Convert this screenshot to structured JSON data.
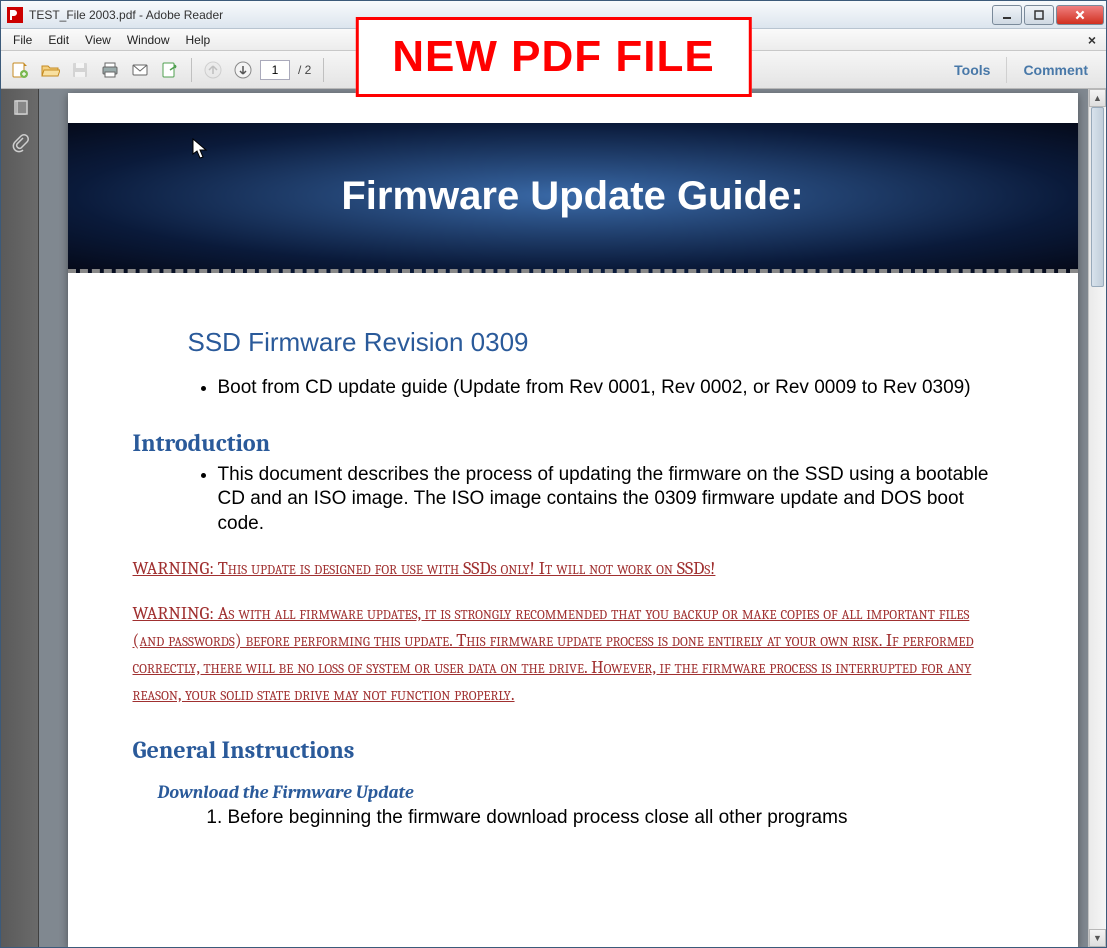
{
  "window": {
    "title": "TEST_File 2003.pdf - Adobe Reader"
  },
  "menu": {
    "file": "File",
    "edit": "Edit",
    "view": "View",
    "window": "Window",
    "help": "Help"
  },
  "toolbar": {
    "page_current": "1",
    "page_total": "/ 2",
    "tools": "Tools",
    "comment": "Comment"
  },
  "overlay": {
    "label": "NEW PDF FILE"
  },
  "document": {
    "banner_title": "Firmware Update Guide:",
    "section1_title": "SSD Firmware Revision 0309",
    "section1_bullets": [
      "Boot from CD update guide (Update from Rev 0001, Rev 0002, or Rev 0009 to Rev 0309)"
    ],
    "intro_heading": "Introduction",
    "intro_bullets": [
      "This document describes the process of updating the firmware on the SSD using a bootable CD and an ISO image. The ISO image contains the 0309 firmware update and DOS boot code."
    ],
    "warning1": "WARNING: This update is designed for use with SSDs only! It will not work on SSDs!",
    "warning2_l1": "WARNING: As with all firmware updates, it is strongly recommended that you backup or make copies of all important files",
    "warning2_l2": "(and passwords) before performing this update. This firmware update process is done entirely at your own risk. If performed",
    "warning2_l3": "correctly, there will be no loss of system or user data on the drive. However, if the firmware process is interrupted for any",
    "warning2_l4": "reason, your solid state drive may not function properly.",
    "general_heading": "General Instructions",
    "download_heading": "Download the Firmware Update",
    "download_step1": "Before beginning the firmware download process close all other programs"
  }
}
